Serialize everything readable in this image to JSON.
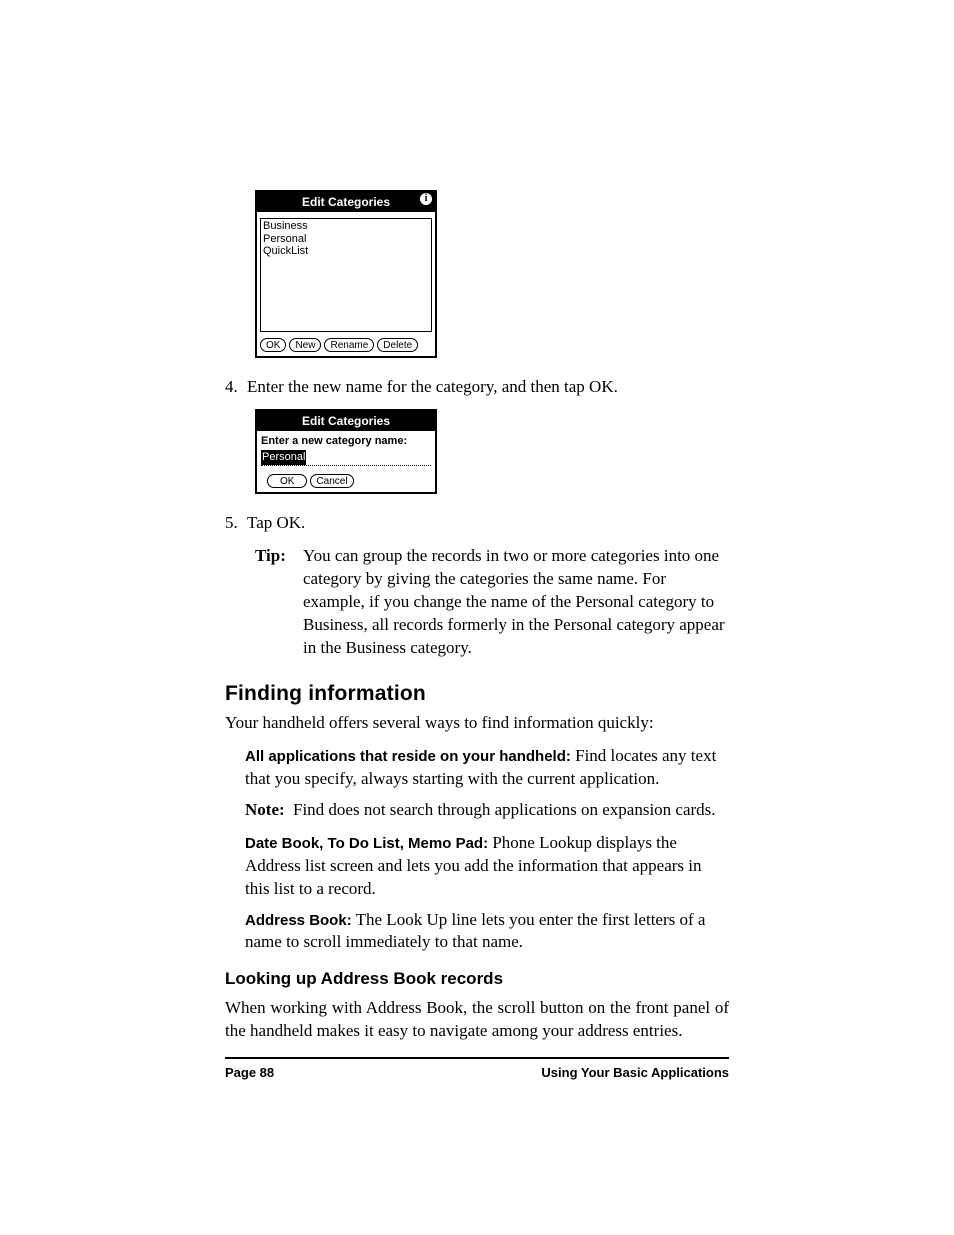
{
  "dialog1": {
    "title": "Edit Categories",
    "info_glyph": "i",
    "items": [
      "Business",
      "Personal",
      "QuickList"
    ],
    "buttons": {
      "ok": "OK",
      "new": "New",
      "rename": "Rename",
      "delete": "Delete"
    }
  },
  "step4": {
    "num": "4.",
    "text": "Enter the new name for the category, and then tap OK."
  },
  "dialog2": {
    "title": "Edit Categories",
    "prompt": "Enter a new category name:",
    "input_value": "Personal",
    "buttons": {
      "ok": "OK",
      "cancel": "Cancel"
    }
  },
  "step5": {
    "num": "5.",
    "text": "Tap OK."
  },
  "tip": {
    "label": "Tip:",
    "text": "You can group the records in two or more categories into one category by giving the categories the same name. For example, if you change the name of the Personal category to Business, all records formerly in the Personal category appear in the Business category."
  },
  "finding": {
    "heading": "Finding information",
    "intro": "Your handheld offers several ways to find information quickly:",
    "para_all_label": "All applications that reside on your handheld:",
    "para_all_text": " Find locates any text that you specify, always starting with the current application.",
    "note_label": "Note:",
    "note_text": "Find does not search through applications on expansion cards.",
    "para_db_label": "Date Book, To Do List, Memo Pad:",
    "para_db_text": " Phone Lookup displays the Address list screen and lets you add the information that appears in this list to a record.",
    "para_ab_label": "Address Book:",
    "para_ab_text": " The Look Up line lets you enter the first letters of a name to scroll immediately to that name."
  },
  "lookup": {
    "heading": "Looking up Address Book records",
    "text": "When working with Address Book, the scroll button on the front panel of the handheld makes it easy to navigate among your address entries."
  },
  "footer": {
    "left": "Page 88",
    "right": "Using Your Basic Applications"
  }
}
